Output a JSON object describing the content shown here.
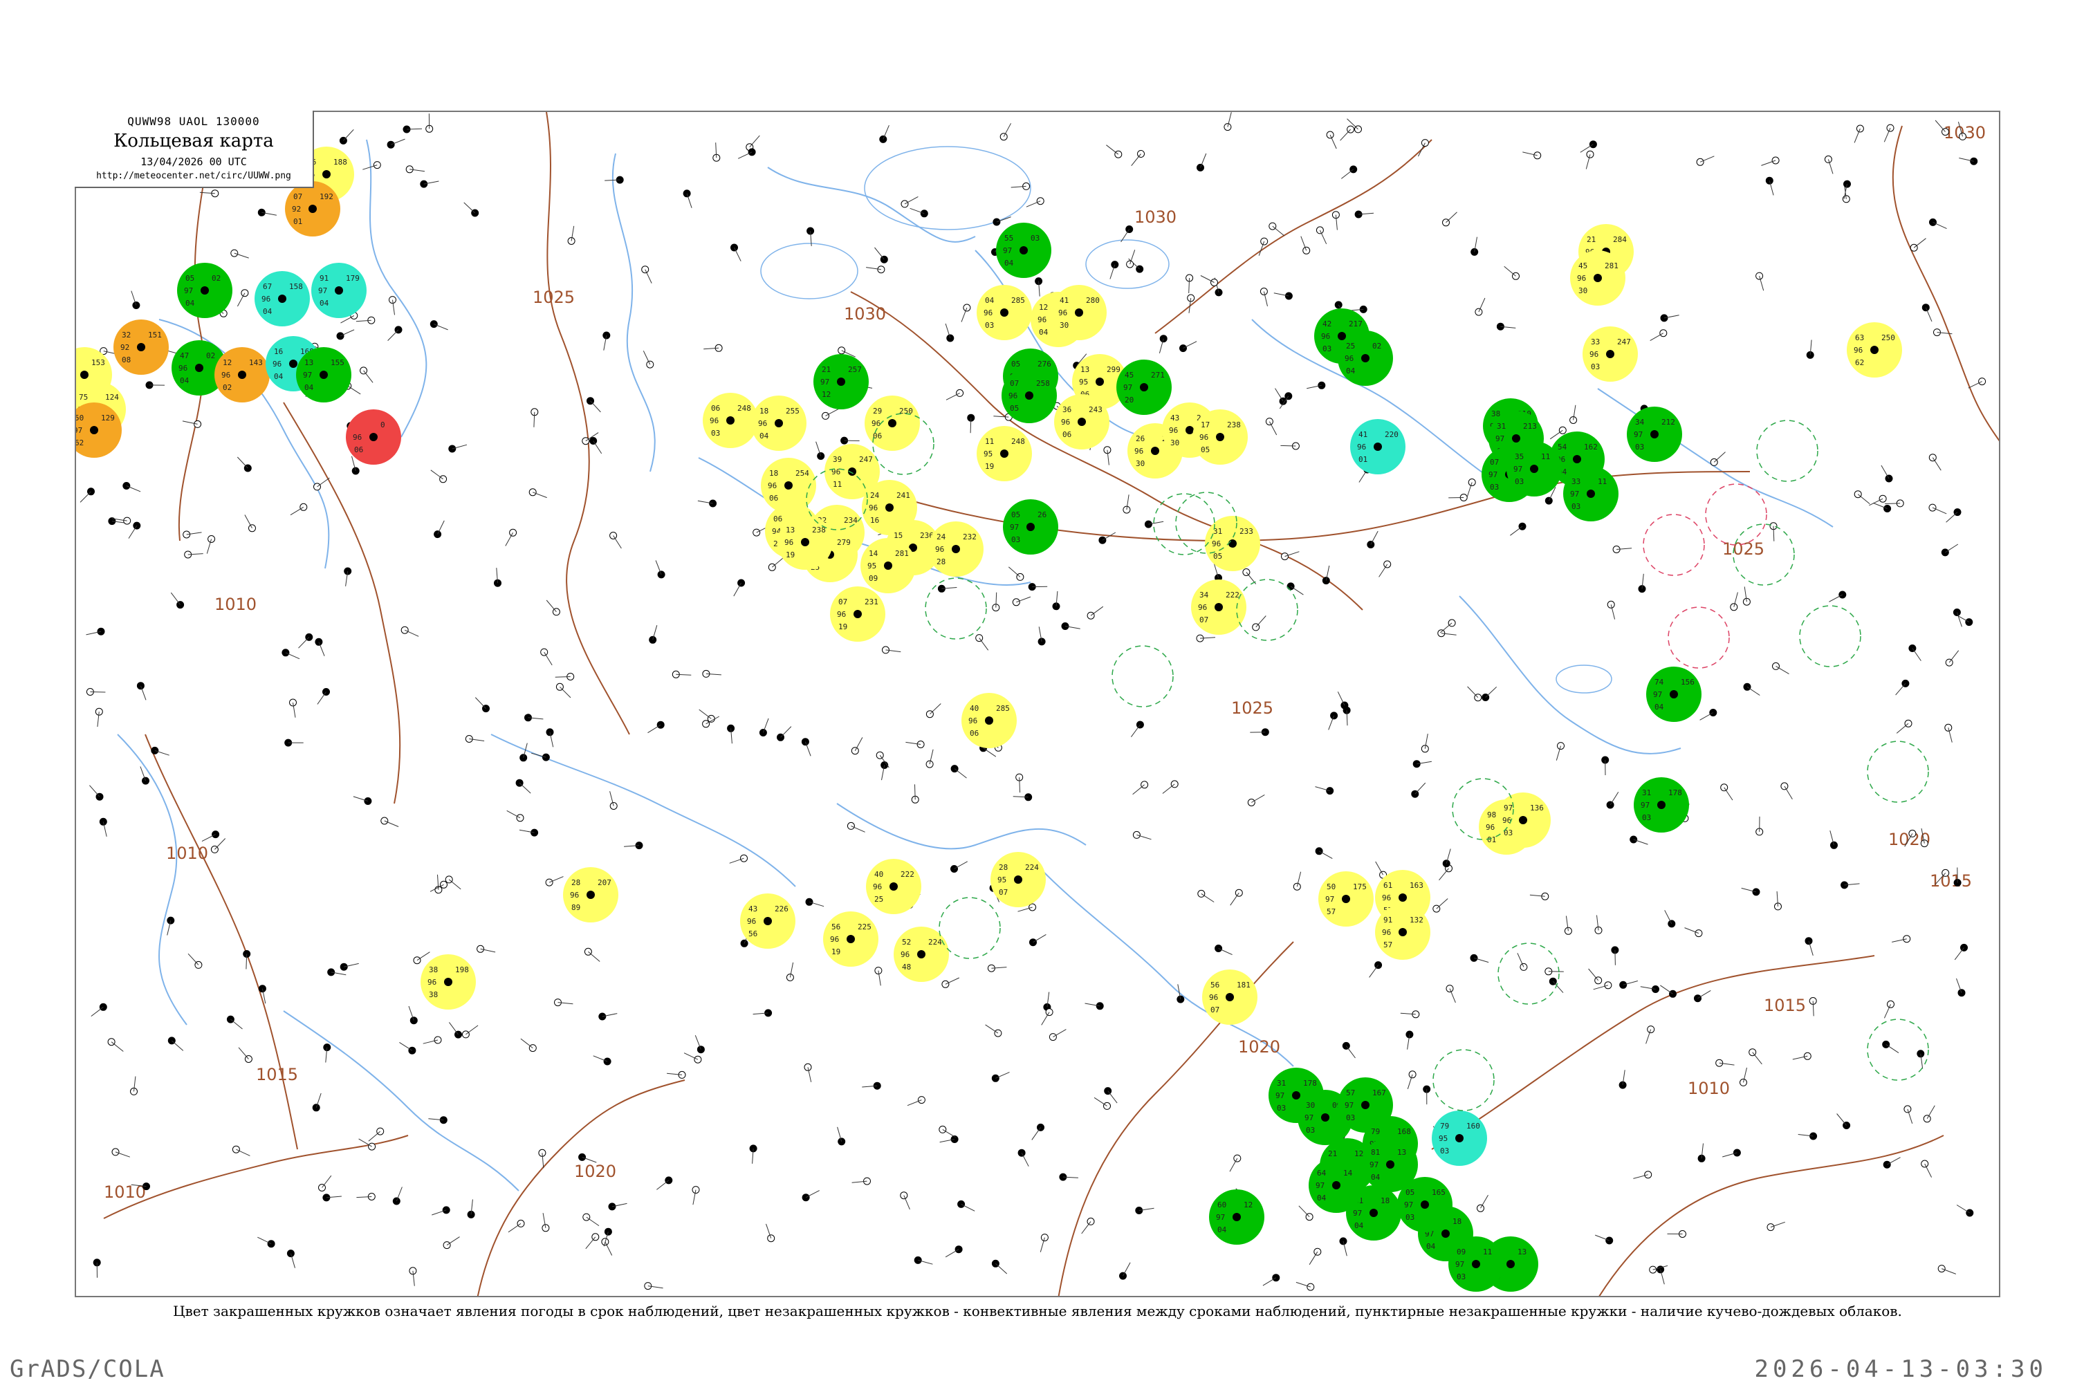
{
  "header": {
    "code": "QUWW98  UAOL  130000",
    "title": "Кольцевая карта",
    "date": "13/04/2026 00 UTC",
    "url": "http://meteocenter.net/circ/UUWW.png"
  },
  "isobars": [
    "1030",
    "1030",
    "1030",
    "1025",
    "1025",
    "1025",
    "1020",
    "1020",
    "1020",
    "1015",
    "1015",
    "1015",
    "1010",
    "1010",
    "1010",
    "1010"
  ],
  "colors": {
    "isobar": "#a0522d",
    "river": "#7fb3ea",
    "frame": "#777777",
    "green_fill": "#00c000",
    "yellow_fill": "#ffff66",
    "orange_fill": "#f5a623",
    "cyan_fill": "#2ee8c8",
    "red_fill": "#ee4444"
  },
  "stations": [
    {
      "kind": "yellow",
      "values": [
        "26",
        "96",
        "19",
        "188"
      ]
    },
    {
      "kind": "orange",
      "values": [
        "07",
        "92",
        "01",
        "192"
      ]
    },
    {
      "kind": "green",
      "values": [
        "05",
        "97",
        "04",
        "02"
      ]
    },
    {
      "kind": "cyan",
      "values": [
        "67",
        "96",
        "04",
        "158"
      ]
    },
    {
      "kind": "cyan",
      "values": [
        "91",
        "97",
        "04",
        "179"
      ]
    },
    {
      "kind": "orange",
      "values": [
        "32",
        "92",
        "08",
        "151"
      ]
    },
    {
      "kind": "yellow",
      "values": [
        "74",
        "95",
        "70",
        "153"
      ]
    },
    {
      "kind": "green",
      "values": [
        "47",
        "96",
        "04",
        "02"
      ]
    },
    {
      "kind": "orange",
      "values": [
        "12",
        "96",
        "02",
        "143"
      ]
    },
    {
      "kind": "cyan",
      "values": [
        "16",
        "96",
        "04",
        "168"
      ]
    },
    {
      "kind": "green",
      "values": [
        "13",
        "97",
        "04",
        "155"
      ]
    },
    {
      "kind": "yellow",
      "values": [
        "75",
        "96",
        "70",
        "124"
      ]
    },
    {
      "kind": "orange",
      "values": [
        "50",
        "97",
        "62",
        "129"
      ]
    },
    {
      "kind": "red",
      "values": [
        "",
        "96",
        "06",
        "0"
      ]
    },
    {
      "kind": "yellow",
      "values": [
        "06",
        "96",
        "03",
        "248"
      ]
    },
    {
      "kind": "yellow",
      "values": [
        "18",
        "96",
        "04",
        "255"
      ]
    },
    {
      "kind": "green",
      "values": [
        "21",
        "97",
        "12",
        "257"
      ]
    },
    {
      "kind": "yellow",
      "values": [
        "18",
        "96",
        "06",
        "254"
      ]
    },
    {
      "kind": "yellow",
      "values": [
        "39",
        "96",
        "11",
        "247"
      ]
    },
    {
      "kind": "yellow",
      "values": [
        "29",
        "96",
        "06",
        "250"
      ]
    },
    {
      "kind": "yellow",
      "values": [
        "24",
        "96",
        "16",
        "241"
      ]
    },
    {
      "kind": "yellow",
      "values": [
        "06",
        "94",
        "20",
        "236"
      ]
    },
    {
      "kind": "yellow",
      "values": [
        "22",
        "97",
        "13",
        "234"
      ]
    },
    {
      "kind": "yellow",
      "values": [
        "15",
        "97",
        "14",
        "236"
      ]
    },
    {
      "kind": "yellow",
      "values": [
        "24",
        "96",
        "28",
        "232"
      ]
    },
    {
      "kind": "yellow",
      "values": [
        "07",
        "96",
        "19",
        "231"
      ]
    },
    {
      "kind": "yellow",
      "values": [
        "19",
        "94",
        "25",
        "279"
      ]
    },
    {
      "kind": "yellow",
      "values": [
        "14",
        "95",
        "09",
        "281"
      ]
    },
    {
      "kind": "yellow",
      "values": [
        "04",
        "96",
        "03",
        "285"
      ]
    },
    {
      "kind": "green",
      "values": [
        "55",
        "97",
        "04",
        "03"
      ]
    },
    {
      "kind": "yellow",
      "values": [
        "12",
        "96",
        "04",
        "285"
      ]
    },
    {
      "kind": "yellow",
      "values": [
        "41",
        "96",
        "30",
        "280"
      ]
    },
    {
      "kind": "yellow",
      "values": [
        "13",
        "95",
        "06",
        "299"
      ]
    },
    {
      "kind": "green",
      "values": [
        "05",
        "97",
        "04",
        "276"
      ]
    },
    {
      "kind": "green",
      "values": [
        "07",
        "96",
        "05",
        "258"
      ]
    },
    {
      "kind": "yellow",
      "values": [
        "11",
        "95",
        "19",
        "248"
      ]
    },
    {
      "kind": "green",
      "values": [
        "05",
        "97",
        "03",
        "26"
      ]
    },
    {
      "kind": "green",
      "values": [
        "45",
        "97",
        "20",
        "271"
      ]
    },
    {
      "kind": "yellow",
      "values": [
        "26",
        "96",
        "30",
        "269"
      ]
    },
    {
      "kind": "yellow",
      "values": [
        "40",
        "96",
        "06",
        "285"
      ]
    },
    {
      "kind": "yellow",
      "values": [
        "36",
        "96",
        "06",
        "243"
      ]
    },
    {
      "kind": "yellow",
      "values": [
        "43",
        "96",
        "30",
        "243"
      ]
    },
    {
      "kind": "yellow",
      "values": [
        "17",
        "96",
        "05",
        "238"
      ]
    },
    {
      "kind": "yellow",
      "values": [
        "31",
        "96",
        "05",
        "233"
      ]
    },
    {
      "kind": "yellow",
      "values": [
        "34",
        "96",
        "07",
        "222"
      ]
    },
    {
      "kind": "yellow",
      "values": [
        "28",
        "95",
        "07",
        "224"
      ]
    },
    {
      "kind": "yellow",
      "values": [
        "52",
        "96",
        "48",
        "224"
      ]
    },
    {
      "kind": "yellow",
      "values": [
        "40",
        "96",
        "25",
        "222"
      ]
    },
    {
      "kind": "yellow",
      "values": [
        "56",
        "96",
        "19",
        "225"
      ]
    },
    {
      "kind": "yellow",
      "values": [
        "43",
        "96",
        "56",
        "226"
      ]
    },
    {
      "kind": "yellow",
      "values": [
        "13",
        "96",
        "19",
        "238"
      ]
    },
    {
      "kind": "yellow",
      "values": [
        "38",
        "96",
        "38",
        "198"
      ]
    },
    {
      "kind": "yellow",
      "values": [
        "28",
        "96",
        "89",
        "207"
      ]
    },
    {
      "kind": "yellow",
      "values": [
        "21",
        "96",
        "07",
        "284"
      ]
    },
    {
      "kind": "yellow",
      "values": [
        "45",
        "96",
        "30",
        "281"
      ]
    },
    {
      "kind": "yellow",
      "values": [
        "61",
        "96",
        "57",
        "163"
      ]
    },
    {
      "kind": "yellow",
      "values": [
        "50",
        "97",
        "57",
        "175"
      ]
    },
    {
      "kind": "yellow",
      "values": [
        "91",
        "96",
        "57",
        "132"
      ]
    },
    {
      "kind": "yellow",
      "values": [
        "56",
        "96",
        "07",
        "181"
      ]
    },
    {
      "kind": "yellow",
      "values": [
        "98",
        "96",
        "01",
        "145"
      ]
    },
    {
      "kind": "yellow",
      "values": [
        "97",
        "96",
        "03",
        "136"
      ]
    },
    {
      "kind": "yellow",
      "values": [
        "63",
        "96",
        "62",
        "250"
      ]
    },
    {
      "kind": "yellow",
      "values": [
        "33",
        "96",
        "03",
        "247"
      ]
    },
    {
      "kind": "green",
      "values": [
        "42",
        "96",
        "03",
        "217"
      ]
    },
    {
      "kind": "green",
      "values": [
        "25",
        "96",
        "04",
        "02"
      ]
    },
    {
      "kind": "green",
      "values": [
        "38",
        "97",
        "03",
        "210"
      ]
    },
    {
      "kind": "green",
      "values": [
        "31",
        "97",
        "04",
        "213"
      ]
    },
    {
      "kind": "green",
      "values": [
        "34",
        "97",
        "03",
        "212"
      ]
    },
    {
      "kind": "cyan",
      "values": [
        "41",
        "96",
        "01",
        "220"
      ]
    },
    {
      "kind": "green",
      "values": [
        "54",
        "96",
        "04",
        "162"
      ]
    },
    {
      "kind": "green",
      "values": [
        "07",
        "97",
        "03",
        "217"
      ]
    },
    {
      "kind": "green",
      "values": [
        "35",
        "97",
        "03",
        "11"
      ]
    },
    {
      "kind": "green",
      "values": [
        "33",
        "97",
        "03",
        "11"
      ]
    },
    {
      "kind": "green",
      "values": [
        "74",
        "97",
        "04",
        "156"
      ]
    },
    {
      "kind": "green",
      "values": [
        "31",
        "97",
        "03",
        "178"
      ]
    },
    {
      "kind": "green",
      "values": [
        "31",
        "97",
        "03",
        "178"
      ]
    },
    {
      "kind": "green",
      "values": [
        "30",
        "97",
        "03",
        "09"
      ]
    },
    {
      "kind": "green",
      "values": [
        "57",
        "97",
        "03",
        "167"
      ]
    },
    {
      "kind": "green",
      "values": [
        "21",
        "97",
        "03",
        "12"
      ]
    },
    {
      "kind": "green",
      "values": [
        "79",
        "97",
        "03",
        "168"
      ]
    },
    {
      "kind": "green",
      "values": [
        "61",
        "97",
        "04",
        "18"
      ]
    },
    {
      "kind": "green",
      "values": [
        "60",
        "97",
        "04",
        "18"
      ]
    },
    {
      "kind": "green",
      "values": [
        "05",
        "97",
        "03",
        "165"
      ]
    },
    {
      "kind": "cyan",
      "values": [
        "79",
        "95",
        "03",
        "160"
      ]
    },
    {
      "kind": "green",
      "values": [
        "60",
        "97",
        "04",
        "12"
      ]
    },
    {
      "kind": "green",
      "values": [
        "79",
        "97",
        "04",
        "13"
      ]
    },
    {
      "kind": "green",
      "values": [
        "09",
        "97",
        "03",
        "11"
      ]
    },
    {
      "kind": "green",
      "values": [
        "64",
        "97",
        "04",
        "14"
      ]
    },
    {
      "kind": "green",
      "values": [
        "81",
        "97",
        "04",
        "13"
      ]
    }
  ],
  "footer": {
    "legend": "Цвет закрашенных кружков означает явления погоды в срок наблюдений, цвет незакрашенных кружков - конвективные явления между сроками наблюдений, пунктирные незакрашенные кружки - наличие кучево-дождевых облаков.",
    "left": "GrADS/COLA",
    "right": "2026-04-13-03:30"
  }
}
